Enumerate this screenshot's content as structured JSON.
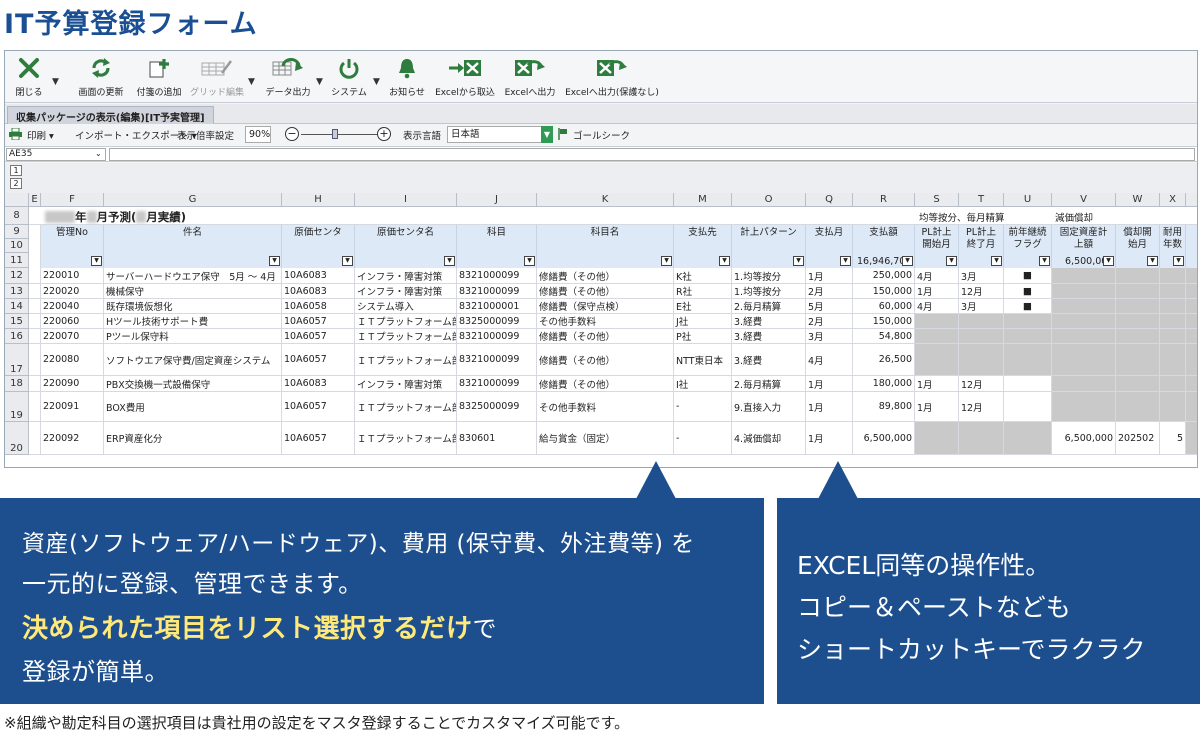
{
  "page_title": "IT予算登録フォーム",
  "toolbar": {
    "buttons": [
      {
        "label": "閉じる",
        "icon": "close-icon"
      },
      {
        "label": "画面の更新",
        "icon": "refresh-icon"
      },
      {
        "label": "付箋の追加",
        "icon": "add-note-icon"
      },
      {
        "label": "グリッド編集",
        "icon": "grid-edit-icon"
      },
      {
        "label": "データ出力",
        "icon": "data-output-icon"
      },
      {
        "label": "システム",
        "icon": "power-icon"
      },
      {
        "label": "お知らせ",
        "icon": "bell-icon"
      },
      {
        "label": "Excelから取込",
        "icon": "excel-import-icon"
      },
      {
        "label": "Excelへ出力",
        "icon": "excel-export-icon"
      },
      {
        "label": "Excelへ出力(保護なし)",
        "icon": "excel-export-unprotected-icon"
      }
    ]
  },
  "tab": {
    "label": "収集パッケージの表示(編集)[IT予実管理]"
  },
  "options_bar": {
    "print": "印刷",
    "import_export": "インポート・エクスポート",
    "zoom_label": "表示倍率設定",
    "zoom_value": "90%",
    "zoom_level_percent": 45,
    "lang_label": "表示言語",
    "lang_value": "日本語",
    "goal_seek": "ゴールシーク"
  },
  "formula_bar": {
    "cell_ref": "AE35",
    "content": ""
  },
  "outline_levels": [
    "1",
    "2"
  ],
  "grid": {
    "columns": [
      "E",
      "F",
      "G",
      "H",
      "I",
      "J",
      "K",
      "M",
      "O",
      "Q",
      "R",
      "S",
      "T",
      "U",
      "V",
      "W",
      "X"
    ],
    "row_numbers": [
      "8",
      "9",
      "10",
      "11",
      "12",
      "13",
      "14",
      "15",
      "16",
      "17",
      "18",
      "19",
      "20"
    ],
    "title_row": {
      "part1": "年",
      "part2": "月予測(",
      "part3": "月実績)"
    },
    "annot_allocation": "均等按分、毎月精算",
    "annot_depreciation": "減価償却",
    "headers": {
      "code": "管理No",
      "name": "件名",
      "cost_center": "原価センタ",
      "cost_center_name": "原価センタ名",
      "account": "科目",
      "account_name": "科目名",
      "payee": "支払先",
      "pattern": "計上パターン",
      "pay_month": "支払月",
      "amount": "支払額",
      "pl_start": "PL計上開始月",
      "pl_end": "PL計上終了月",
      "prior_flag": "前年継続フラグ",
      "fixed_asset": "固定資産計上額",
      "dep_start": "償却開始月",
      "useful_life": "耐用年数"
    },
    "amount_total": "16,946,70",
    "fixed_asset_total": "6,500,00",
    "rows": [
      {
        "rn": "12",
        "code": "220010",
        "name": "サーバーハードウエア保守　5月 ～ 4月",
        "cc": "10A6083",
        "ccname": "インフラ・障害対策",
        "acct": "8321000099",
        "acctname": "修繕費（その他）",
        "payee": "K社",
        "pattern": "1.均等按分",
        "pm": "1月",
        "amt": "250,000",
        "pls": "4月",
        "ple": "3月",
        "flag": "■",
        "fa": "",
        "ds": "",
        "life": ""
      },
      {
        "rn": "13",
        "code": "220020",
        "name": "機械保守",
        "cc": "10A6083",
        "ccname": "インフラ・障害対策",
        "acct": "8321000099",
        "acctname": "修繕費（その他）",
        "payee": "R社",
        "pattern": "1.均等按分",
        "pm": "2月",
        "amt": "150,000",
        "pls": "1月",
        "ple": "12月",
        "flag": "■",
        "fa": "",
        "ds": "",
        "life": ""
      },
      {
        "rn": "14",
        "code": "220040",
        "name": "既存環境仮想化",
        "cc": "10A6058",
        "ccname": "システム導入",
        "acct": "8321000001",
        "acctname": "修繕費（保守点検）",
        "payee": "E社",
        "pattern": "2.毎月精算",
        "pm": "5月",
        "amt": "60,000",
        "pls": "4月",
        "ple": "3月",
        "flag": "■",
        "fa": "",
        "ds": "",
        "life": ""
      },
      {
        "rn": "15",
        "code": "220060",
        "name": "Hツール技術サポート費",
        "cc": "10A6057",
        "ccname": "ＩＴプラットフォーム部",
        "acct": "8325000099",
        "acctname": "その他手数料",
        "payee": "J社",
        "pattern": "3.経費",
        "pm": "2月",
        "amt": "150,000",
        "pls": "",
        "ple": "",
        "flag": "",
        "fa": "",
        "ds": "",
        "life": ""
      },
      {
        "rn": "16",
        "code": "220070",
        "name": "Pツール保守料",
        "cc": "10A6057",
        "ccname": "ＩＴプラットフォーム部",
        "acct": "8321000099",
        "acctname": "修繕費（その他）",
        "payee": "P社",
        "pattern": "3.経費",
        "pm": "3月",
        "amt": "54,800",
        "pls": "",
        "ple": "",
        "flag": "",
        "fa": "",
        "ds": "",
        "life": ""
      },
      {
        "rn": "17",
        "code": "220080",
        "name": "ソフトウエア保守費/固定資産システム",
        "cc": "10A6057",
        "ccname": "ＩＴプラットフォーム部",
        "acct": "8321000099",
        "acctname": "修繕費（その他）",
        "payee": "NTT東日本",
        "pattern": "3.経費",
        "pm": "4月",
        "amt": "26,500",
        "pls": "",
        "ple": "",
        "flag": "",
        "fa": "",
        "ds": "",
        "life": ""
      },
      {
        "rn": "18",
        "code": "220090",
        "name": "PBX交換機一式設備保守",
        "cc": "10A6083",
        "ccname": "インフラ・障害対策",
        "acct": "8321000099",
        "acctname": "修繕費（その他）",
        "payee": "I社",
        "pattern": "2.毎月精算",
        "pm": "1月",
        "amt": "180,000",
        "pls": "1月",
        "ple": "12月",
        "flag": "",
        "fa": "",
        "ds": "",
        "life": ""
      },
      {
        "rn": "19",
        "code": "220091",
        "name": "BOX費用",
        "cc": "10A6057",
        "ccname": "ＩＴプラットフォーム部",
        "acct": "8325000099",
        "acctname": "その他手数料",
        "payee": "-",
        "pattern": "9.直接入力",
        "pm": "1月",
        "amt": "89,800",
        "pls": "1月",
        "ple": "12月",
        "flag": "",
        "fa": "",
        "ds": "",
        "life": ""
      },
      {
        "rn": "20",
        "code": "220092",
        "name": "ERP資産化分",
        "cc": "10A6057",
        "ccname": "ＩＴプラットフォーム部",
        "acct": "830601",
        "acctname": "給与賞金（固定）",
        "payee": "-",
        "pattern": "4.減価償却",
        "pm": "1月",
        "amt": "6,500,000",
        "pls": "",
        "ple": "",
        "flag": "",
        "fa": "6,500,000",
        "ds": "202502",
        "life": "5"
      }
    ]
  },
  "callout_left": {
    "line1": "資産(ソフトウェア/ハードウェア)、費用 (保守費、外注費等) を",
    "line2": "一元的に登録、管理できます。",
    "line3_emph": "決められた項目をリスト選択するだけ",
    "line3_rest": "で",
    "line4": "登録が簡単。"
  },
  "callout_right": {
    "line1": "EXCEL同等の操作性。",
    "line2": "コピー＆ペーストなども",
    "line3": "ショートカットキーでラクラク"
  },
  "footnote": "※組織や勘定科目の選択項目は貴社用の設定をマスタ登録することでカスタマイズ可能です。",
  "colors": {
    "brand": "#1b4f93",
    "callout_bg": "#1d4f8f",
    "emph_text": "#ffe97a",
    "header_bg": "#dde9f6",
    "locked_gray": "#c9c9c9",
    "excel_green": "#2f7d3e"
  }
}
